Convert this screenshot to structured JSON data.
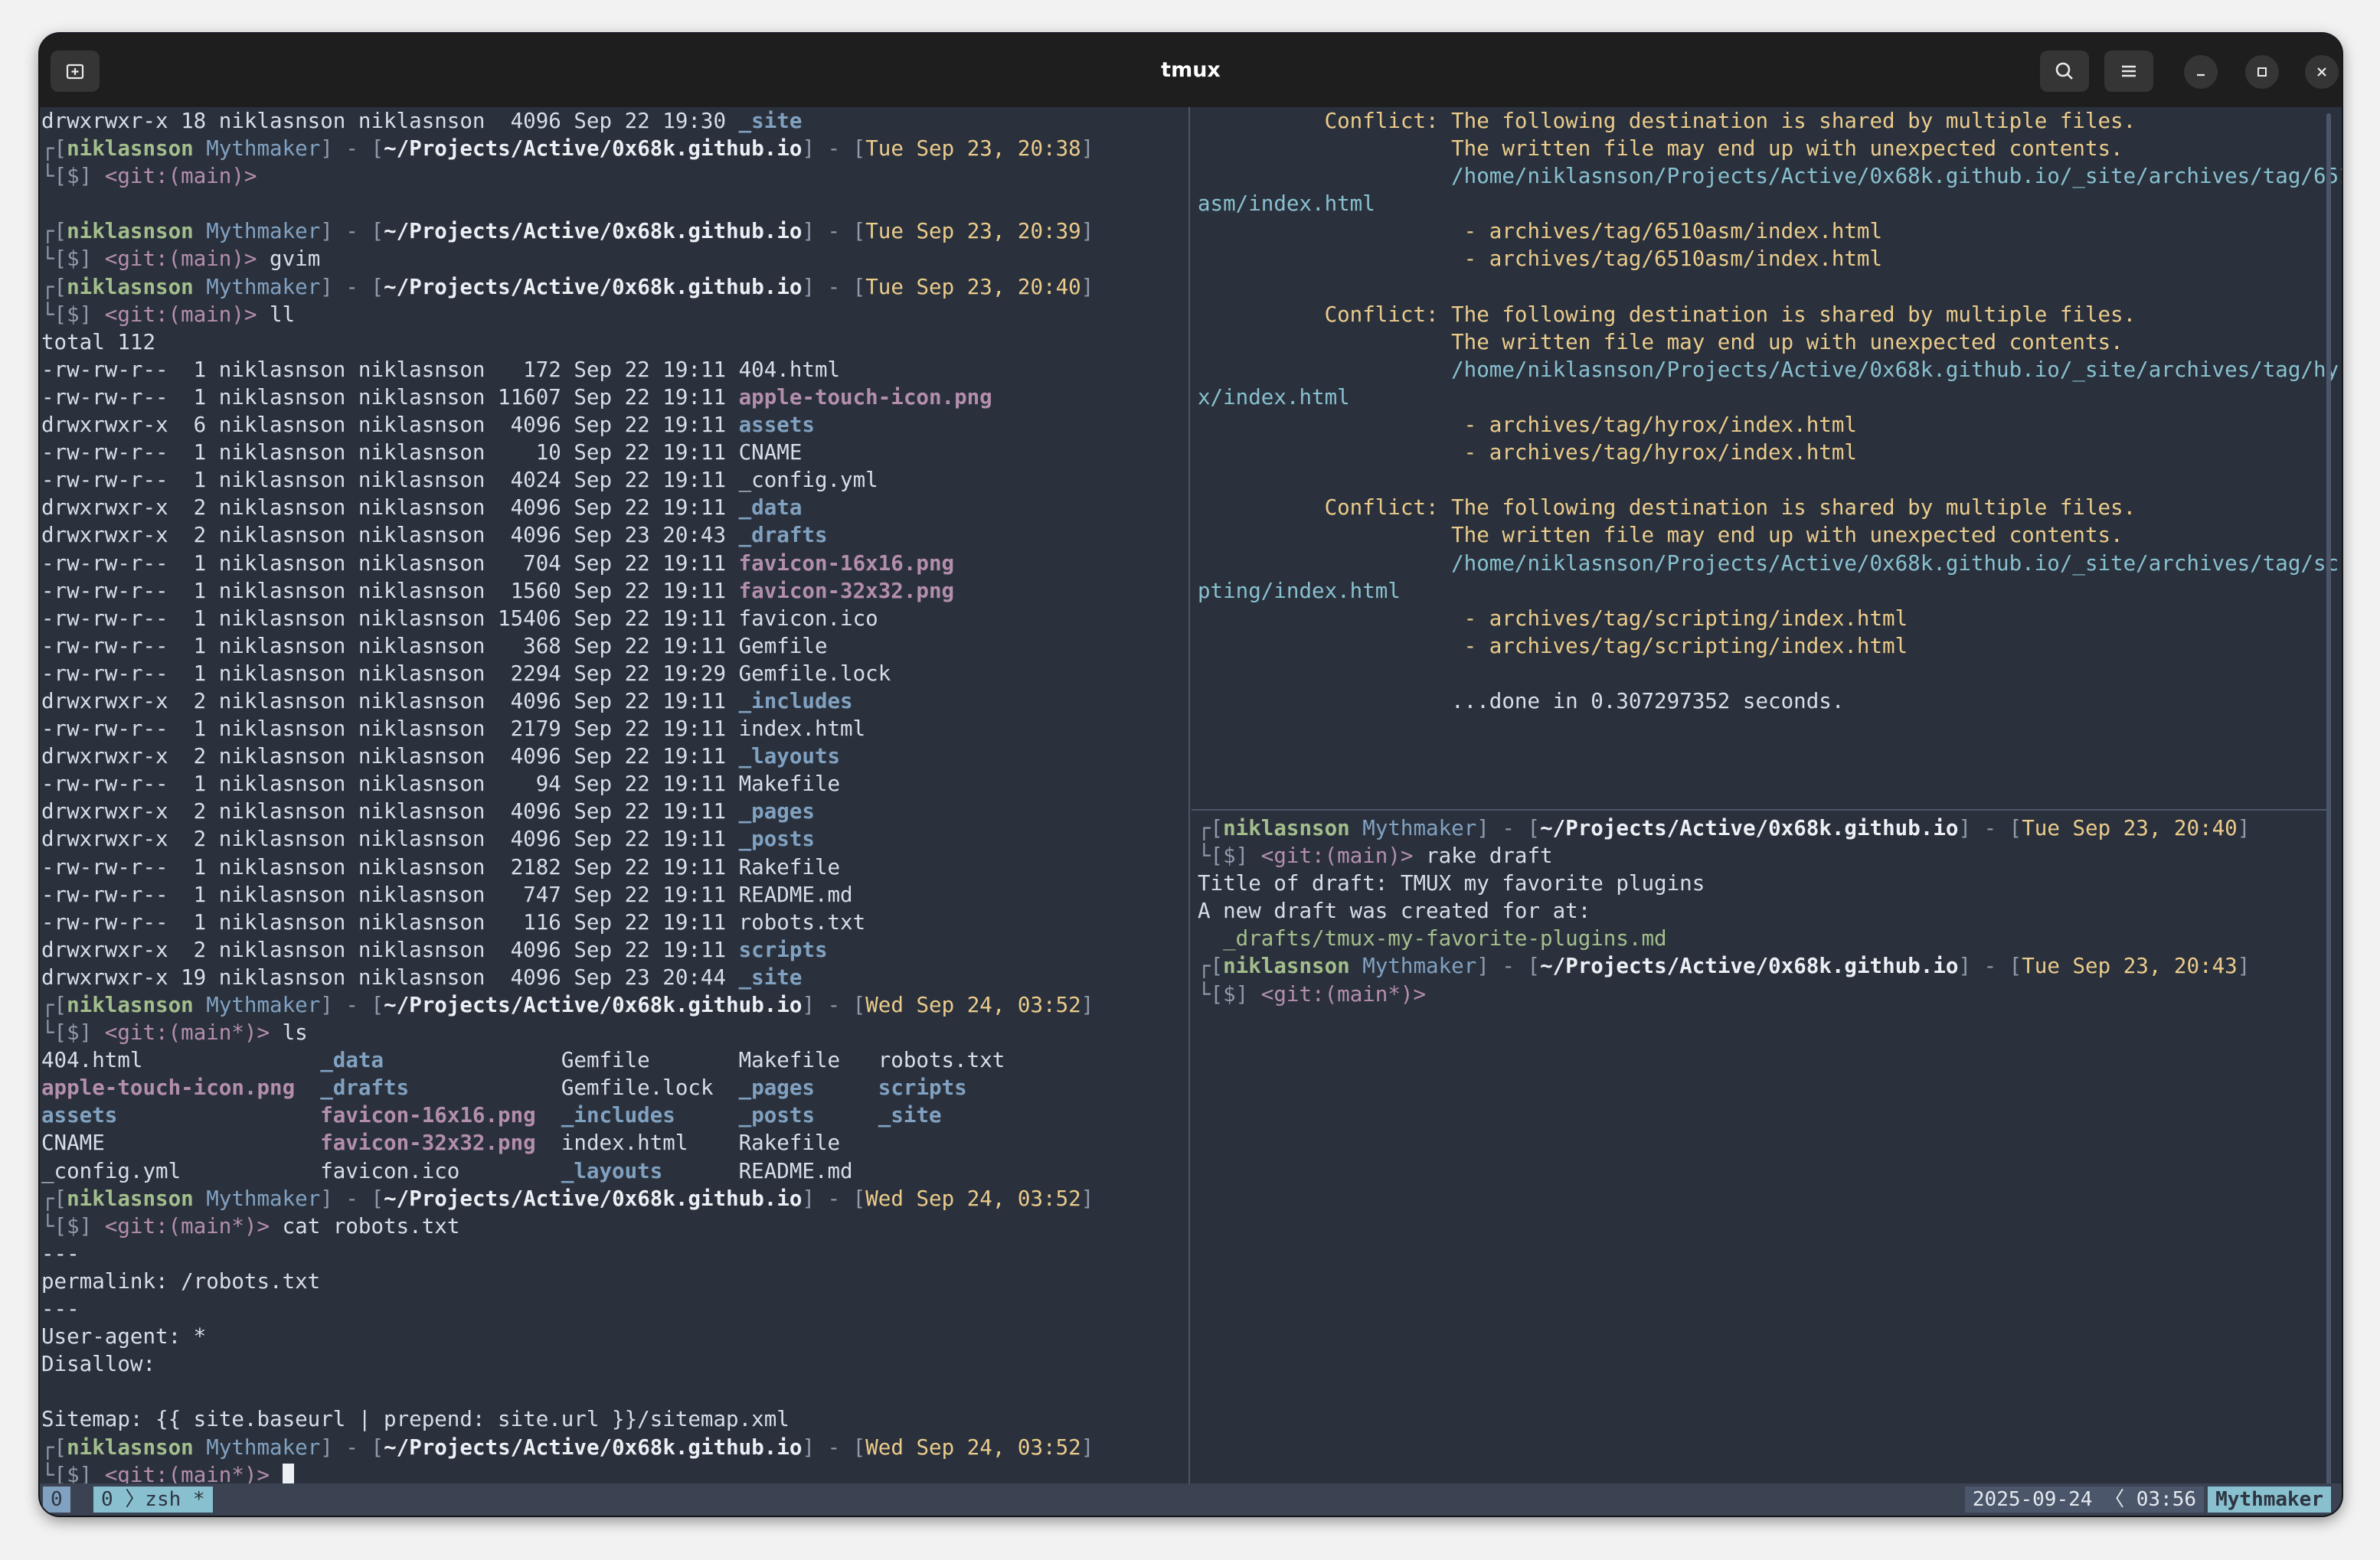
{
  "window": {
    "title": "tmux"
  },
  "left_pane": [
    [
      [
        "drwxrwxr-x 18 niklasnson niklasnson  4096 Sep 22 19:30 ",
        ""
      ],
      [
        "_site",
        "dir"
      ]
    ],
    [
      [
        "┌[",
        "fr"
      ],
      [
        "niklasnson",
        "us"
      ],
      [
        " Mythmaker",
        "hn"
      ],
      [
        "] - [",
        "fr"
      ],
      [
        "~/Projects/Active/0x68k.github.io",
        "pa"
      ],
      [
        "] - [",
        "fr"
      ],
      [
        "Tue Sep 23, 20:38",
        "dt"
      ],
      [
        "]",
        "fr"
      ]
    ],
    [
      [
        "└[$] ",
        "fr"
      ],
      [
        "<git:(main)>",
        "gi"
      ]
    ],
    [],
    [
      [
        "┌[",
        "fr"
      ],
      [
        "niklasnson",
        "us"
      ],
      [
        " Mythmaker",
        "hn"
      ],
      [
        "] - [",
        "fr"
      ],
      [
        "~/Projects/Active/0x68k.github.io",
        "pa"
      ],
      [
        "] - [",
        "fr"
      ],
      [
        "Tue Sep 23, 20:39",
        "dt"
      ],
      [
        "]",
        "fr"
      ]
    ],
    [
      [
        "└[$] ",
        "fr"
      ],
      [
        "<git:(main)>",
        "gi"
      ],
      [
        " gvim",
        ""
      ]
    ],
    [
      [
        "┌[",
        "fr"
      ],
      [
        "niklasnson",
        "us"
      ],
      [
        " Mythmaker",
        "hn"
      ],
      [
        "] - [",
        "fr"
      ],
      [
        "~/Projects/Active/0x68k.github.io",
        "pa"
      ],
      [
        "] - [",
        "fr"
      ],
      [
        "Tue Sep 23, 20:40",
        "dt"
      ],
      [
        "]",
        "fr"
      ]
    ],
    [
      [
        "└[$] ",
        "fr"
      ],
      [
        "<git:(main)>",
        "gi"
      ],
      [
        " ll",
        ""
      ]
    ],
    [
      [
        "total 112",
        ""
      ]
    ],
    [
      [
        "-rw-rw-r--  1 niklasnson niklasnson   172 Sep 22 19:11 404.html",
        ""
      ]
    ],
    [
      [
        "-rw-rw-r--  1 niklasnson niklasnson 11607 Sep 22 19:11 ",
        ""
      ],
      [
        "apple-touch-icon.png",
        "img"
      ]
    ],
    [
      [
        "drwxrwxr-x  6 niklasnson niklasnson  4096 Sep 22 19:11 ",
        ""
      ],
      [
        "assets",
        "dir"
      ]
    ],
    [
      [
        "-rw-rw-r--  1 niklasnson niklasnson    10 Sep 22 19:11 CNAME",
        ""
      ]
    ],
    [
      [
        "-rw-rw-r--  1 niklasnson niklasnson  4024 Sep 22 19:11 _config.yml",
        ""
      ]
    ],
    [
      [
        "drwxrwxr-x  2 niklasnson niklasnson  4096 Sep 22 19:11 ",
        ""
      ],
      [
        "_data",
        "dir"
      ]
    ],
    [
      [
        "drwxrwxr-x  2 niklasnson niklasnson  4096 Sep 23 20:43 ",
        ""
      ],
      [
        "_drafts",
        "dir"
      ]
    ],
    [
      [
        "-rw-rw-r--  1 niklasnson niklasnson   704 Sep 22 19:11 ",
        ""
      ],
      [
        "favicon-16x16.png",
        "img"
      ]
    ],
    [
      [
        "-rw-rw-r--  1 niklasnson niklasnson  1560 Sep 22 19:11 ",
        ""
      ],
      [
        "favicon-32x32.png",
        "img"
      ]
    ],
    [
      [
        "-rw-rw-r--  1 niklasnson niklasnson 15406 Sep 22 19:11 favicon.ico",
        ""
      ]
    ],
    [
      [
        "-rw-rw-r--  1 niklasnson niklasnson   368 Sep 22 19:11 Gemfile",
        ""
      ]
    ],
    [
      [
        "-rw-rw-r--  1 niklasnson niklasnson  2294 Sep 22 19:29 Gemfile.lock",
        ""
      ]
    ],
    [
      [
        "drwxrwxr-x  2 niklasnson niklasnson  4096 Sep 22 19:11 ",
        ""
      ],
      [
        "_includes",
        "dir"
      ]
    ],
    [
      [
        "-rw-rw-r--  1 niklasnson niklasnson  2179 Sep 22 19:11 index.html",
        ""
      ]
    ],
    [
      [
        "drwxrwxr-x  2 niklasnson niklasnson  4096 Sep 22 19:11 ",
        ""
      ],
      [
        "_layouts",
        "dir"
      ]
    ],
    [
      [
        "-rw-rw-r--  1 niklasnson niklasnson    94 Sep 22 19:11 Makefile",
        ""
      ]
    ],
    [
      [
        "drwxrwxr-x  2 niklasnson niklasnson  4096 Sep 22 19:11 ",
        ""
      ],
      [
        "_pages",
        "dir"
      ]
    ],
    [
      [
        "drwxrwxr-x  2 niklasnson niklasnson  4096 Sep 22 19:11 ",
        ""
      ],
      [
        "_posts",
        "dir"
      ]
    ],
    [
      [
        "-rw-rw-r--  1 niklasnson niklasnson  2182 Sep 22 19:11 Rakefile",
        ""
      ]
    ],
    [
      [
        "-rw-rw-r--  1 niklasnson niklasnson   747 Sep 22 19:11 README.md",
        ""
      ]
    ],
    [
      [
        "-rw-rw-r--  1 niklasnson niklasnson   116 Sep 22 19:11 robots.txt",
        ""
      ]
    ],
    [
      [
        "drwxrwxr-x  2 niklasnson niklasnson  4096 Sep 22 19:11 ",
        ""
      ],
      [
        "scripts",
        "dir"
      ]
    ],
    [
      [
        "drwxrwxr-x 19 niklasnson niklasnson  4096 Sep 23 20:44 ",
        ""
      ],
      [
        "_site",
        "dir"
      ]
    ],
    [
      [
        "┌[",
        "fr"
      ],
      [
        "niklasnson",
        "us"
      ],
      [
        " Mythmaker",
        "hn"
      ],
      [
        "] - [",
        "fr"
      ],
      [
        "~/Projects/Active/0x68k.github.io",
        "pa"
      ],
      [
        "] - [",
        "fr"
      ],
      [
        "Wed Sep 24, 03:52",
        "dt"
      ],
      [
        "]",
        "fr"
      ]
    ],
    [
      [
        "└[$] ",
        "fr"
      ],
      [
        "<git:(main*)>",
        "gi"
      ],
      [
        " ls",
        ""
      ]
    ],
    [
      [
        "404.html              ",
        ""
      ],
      [
        "_data",
        "dir"
      ],
      [
        "              Gemfile       Makefile   robots.txt",
        ""
      ]
    ],
    [
      [
        "apple-touch-icon.png",
        "img"
      ],
      [
        "  ",
        ""
      ],
      [
        "_drafts",
        "dir"
      ],
      [
        "            Gemfile.lock  ",
        ""
      ],
      [
        "_pages",
        "dir"
      ],
      [
        "     ",
        ""
      ],
      [
        "scripts",
        "dir"
      ]
    ],
    [
      [
        "assets",
        "dir"
      ],
      [
        "                ",
        ""
      ],
      [
        "favicon-16x16.png",
        "img"
      ],
      [
        "  ",
        ""
      ],
      [
        "_includes",
        "dir"
      ],
      [
        "     ",
        ""
      ],
      [
        "_posts",
        "dir"
      ],
      [
        "     ",
        ""
      ],
      [
        "_site",
        "dir"
      ]
    ],
    [
      [
        "CNAME                 ",
        ""
      ],
      [
        "favicon-32x32.png",
        "img"
      ],
      [
        "  index.html    Rakefile",
        ""
      ]
    ],
    [
      [
        "_config.yml           favicon.ico        ",
        ""
      ],
      [
        "_layouts",
        "dir"
      ],
      [
        "      README.md",
        ""
      ]
    ],
    [
      [
        "┌[",
        "fr"
      ],
      [
        "niklasnson",
        "us"
      ],
      [
        " Mythmaker",
        "hn"
      ],
      [
        "] - [",
        "fr"
      ],
      [
        "~/Projects/Active/0x68k.github.io",
        "pa"
      ],
      [
        "] - [",
        "fr"
      ],
      [
        "Wed Sep 24, 03:52",
        "dt"
      ],
      [
        "]",
        "fr"
      ]
    ],
    [
      [
        "└[$] ",
        "fr"
      ],
      [
        "<git:(main*)>",
        "gi"
      ],
      [
        " cat robots.txt",
        ""
      ]
    ],
    [
      [
        "---",
        ""
      ]
    ],
    [
      [
        "permalink: /robots.txt",
        ""
      ]
    ],
    [
      [
        "---",
        ""
      ]
    ],
    [
      [
        "User-agent: *",
        ""
      ]
    ],
    [
      [
        "Disallow:",
        ""
      ]
    ],
    [],
    [
      [
        "Sitemap: {{ site.baseurl | prepend: site.url }}/sitemap.xml",
        ""
      ]
    ],
    [
      [
        "┌[",
        "fr"
      ],
      [
        "niklasnson",
        "us"
      ],
      [
        " Mythmaker",
        "hn"
      ],
      [
        "] - [",
        "fr"
      ],
      [
        "~/Projects/Active/0x68k.github.io",
        "pa"
      ],
      [
        "] - [",
        "fr"
      ],
      [
        "Wed Sep 24, 03:52",
        "dt"
      ],
      [
        "]",
        "fr"
      ]
    ],
    [
      [
        "└[$] ",
        "fr"
      ],
      [
        "<git:(main*)>",
        "gi"
      ],
      [
        " ",
        ""
      ],
      [
        "",
        "cursor"
      ]
    ]
  ],
  "right_top_pane": [
    [
      [
        "          Conflict: The following destination is shared by multiple files.",
        "warn"
      ]
    ],
    [
      [
        "                    The written file may end up with unexpected contents.",
        "warn"
      ]
    ],
    [
      [
        "                    /home/niklasnson/Projects/Active/0x68k.github.io/_site/archives/tag/6510",
        "pth"
      ]
    ],
    [
      [
        "asm/index.html",
        "pth"
      ]
    ],
    [
      [
        "                     - archives/tag/6510asm/index.html",
        "warn"
      ]
    ],
    [
      [
        "                     - archives/tag/6510asm/index.html",
        "warn"
      ]
    ],
    [],
    [
      [
        "          Conflict: The following destination is shared by multiple files.",
        "warn"
      ]
    ],
    [
      [
        "                    The written file may end up with unexpected contents.",
        "warn"
      ]
    ],
    [
      [
        "                    /home/niklasnson/Projects/Active/0x68k.github.io/_site/archives/tag/hyro",
        "pth"
      ]
    ],
    [
      [
        "x/index.html",
        "pth"
      ]
    ],
    [
      [
        "                     - archives/tag/hyrox/index.html",
        "warn"
      ]
    ],
    [
      [
        "                     - archives/tag/hyrox/index.html",
        "warn"
      ]
    ],
    [],
    [
      [
        "          Conflict: The following destination is shared by multiple files.",
        "warn"
      ]
    ],
    [
      [
        "                    The written file may end up with unexpected contents.",
        "warn"
      ]
    ],
    [
      [
        "                    /home/niklasnson/Projects/Active/0x68k.github.io/_site/archives/tag/scri",
        "pth"
      ]
    ],
    [
      [
        "pting/index.html",
        "pth"
      ]
    ],
    [
      [
        "                     - archives/tag/scripting/index.html",
        "warn"
      ]
    ],
    [
      [
        "                     - archives/tag/scripting/index.html",
        "warn"
      ]
    ],
    [],
    [
      [
        "                    ...done in 0.307297352 seconds.",
        ""
      ]
    ]
  ],
  "right_bottom_pane": [
    [
      [
        "┌[",
        "fr"
      ],
      [
        "niklasnson",
        "us"
      ],
      [
        " Mythmaker",
        "hn"
      ],
      [
        "] - [",
        "fr"
      ],
      [
        "~/Projects/Active/0x68k.github.io",
        "pa"
      ],
      [
        "] - [",
        "fr"
      ],
      [
        "Tue Sep 23, 20:40",
        "dt"
      ],
      [
        "]",
        "fr"
      ]
    ],
    [
      [
        "└[$] ",
        "fr"
      ],
      [
        "<git:(main)>",
        "gi"
      ],
      [
        " rake draft",
        ""
      ]
    ],
    [
      [
        "Title of draft: TMUX my favorite plugins",
        ""
      ]
    ],
    [
      [
        "A new draft was created for at:",
        ""
      ]
    ],
    [
      [
        "  _drafts/tmux-my-favorite-plugins.md",
        "drft"
      ]
    ],
    [
      [
        "┌[",
        "fr"
      ],
      [
        "niklasnson",
        "us"
      ],
      [
        " Mythmaker",
        "hn"
      ],
      [
        "] - [",
        "fr"
      ],
      [
        "~/Projects/Active/0x68k.github.io",
        "pa"
      ],
      [
        "] - [",
        "fr"
      ],
      [
        "Tue Sep 23, 20:43",
        "dt"
      ],
      [
        "]",
        "fr"
      ]
    ],
    [
      [
        "└[$] ",
        "fr"
      ],
      [
        "<git:(main*)>",
        "gi"
      ]
    ]
  ],
  "status_bar": {
    "session": "0",
    "window": "0 〉zsh *",
    "date_time": "2025-09-24 〈 03:56",
    "host": "Mythmaker"
  },
  "icons": [
    "new-tab-icon",
    "search-icon",
    "menu-icon",
    "minimize-icon",
    "maximize-icon",
    "close-icon"
  ]
}
